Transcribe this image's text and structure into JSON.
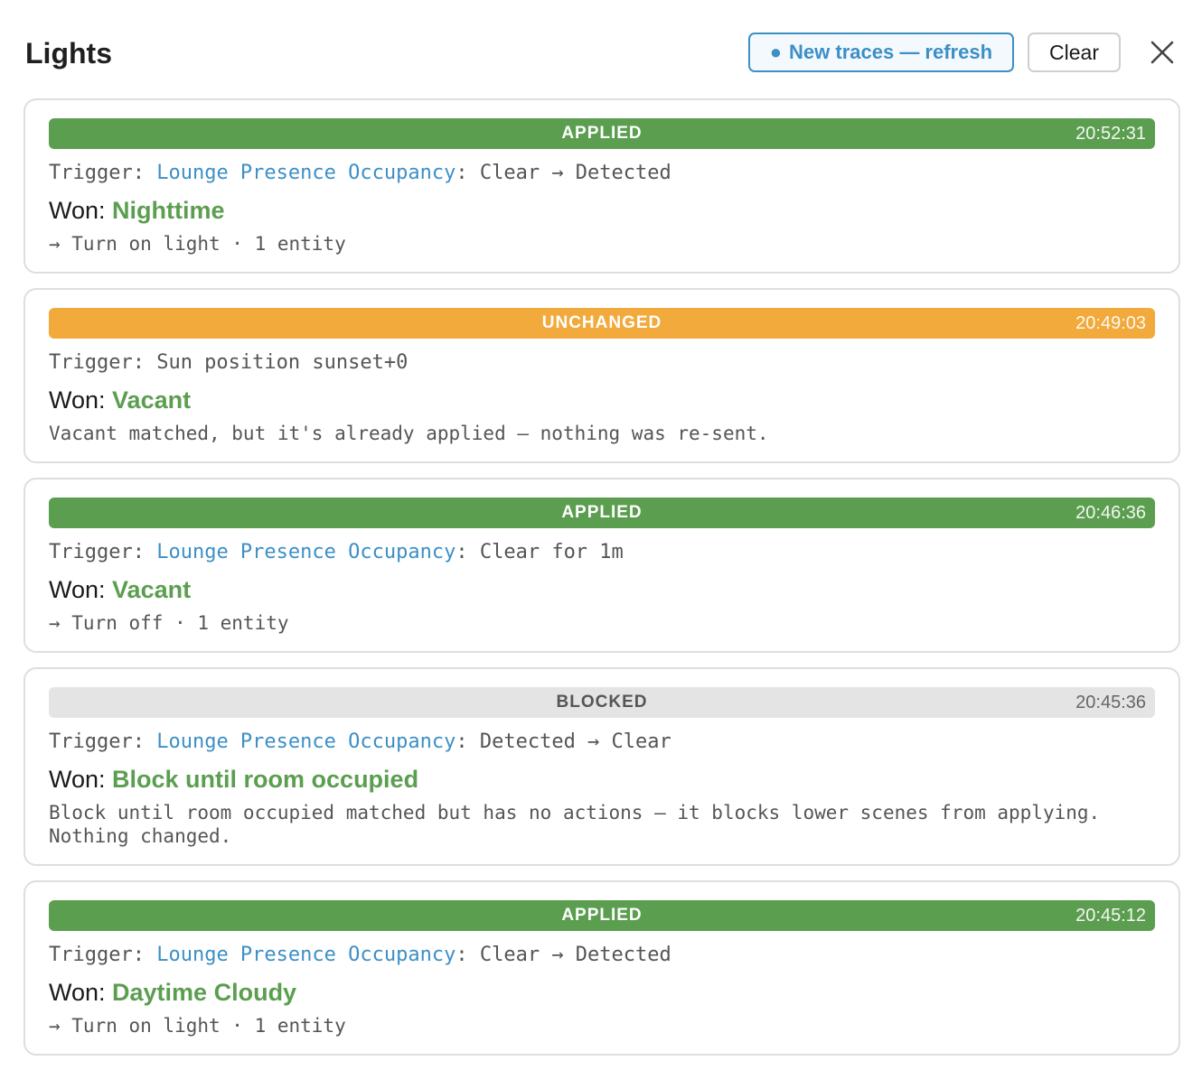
{
  "header": {
    "title": "Lights",
    "refresh_dot": "●",
    "refresh_label": "New traces — refresh",
    "clear_label": "Clear",
    "close_icon": "close-icon"
  },
  "colors": {
    "applied": "#5c9e50",
    "unchanged": "#f1aa3b",
    "blocked": "#e4e4e4",
    "link": "#3d8fc6",
    "scene": "#5c9e50"
  },
  "traces": [
    {
      "status": "APPLIED",
      "kind": "applied",
      "time": "20:52:31",
      "trigger_prefix": "Trigger: ",
      "trigger_entity": "Lounge Presence Occupancy",
      "trigger_rest": ": Clear → Detected",
      "won_prefix": "Won: ",
      "won_scene": "Nighttime",
      "detail": "→ Turn on light · 1 entity"
    },
    {
      "status": "UNCHANGED",
      "kind": "unchanged",
      "time": "20:49:03",
      "trigger_prefix": "Trigger: Sun position sunset+0",
      "trigger_entity": "",
      "trigger_rest": "",
      "won_prefix": "Won: ",
      "won_scene": "Vacant",
      "detail": "Vacant matched, but it's already applied — nothing was re-sent."
    },
    {
      "status": "APPLIED",
      "kind": "applied",
      "time": "20:46:36",
      "trigger_prefix": "Trigger: ",
      "trigger_entity": "Lounge Presence Occupancy",
      "trigger_rest": ": Clear for 1m",
      "won_prefix": "Won: ",
      "won_scene": "Vacant",
      "detail": "→ Turn off · 1 entity"
    },
    {
      "status": "BLOCKED",
      "kind": "blocked",
      "time": "20:45:36",
      "trigger_prefix": "Trigger: ",
      "trigger_entity": "Lounge Presence Occupancy",
      "trigger_rest": ": Detected → Clear",
      "won_prefix": "Won: ",
      "won_scene": "Block until room occupied",
      "detail": "Block until room occupied matched but has no actions — it blocks lower scenes from applying. Nothing changed."
    },
    {
      "status": "APPLIED",
      "kind": "applied",
      "time": "20:45:12",
      "trigger_prefix": "Trigger: ",
      "trigger_entity": "Lounge Presence Occupancy",
      "trigger_rest": ": Clear → Detected",
      "won_prefix": "Won: ",
      "won_scene": "Daytime Cloudy",
      "detail": "→ Turn on light · 1 entity"
    }
  ]
}
